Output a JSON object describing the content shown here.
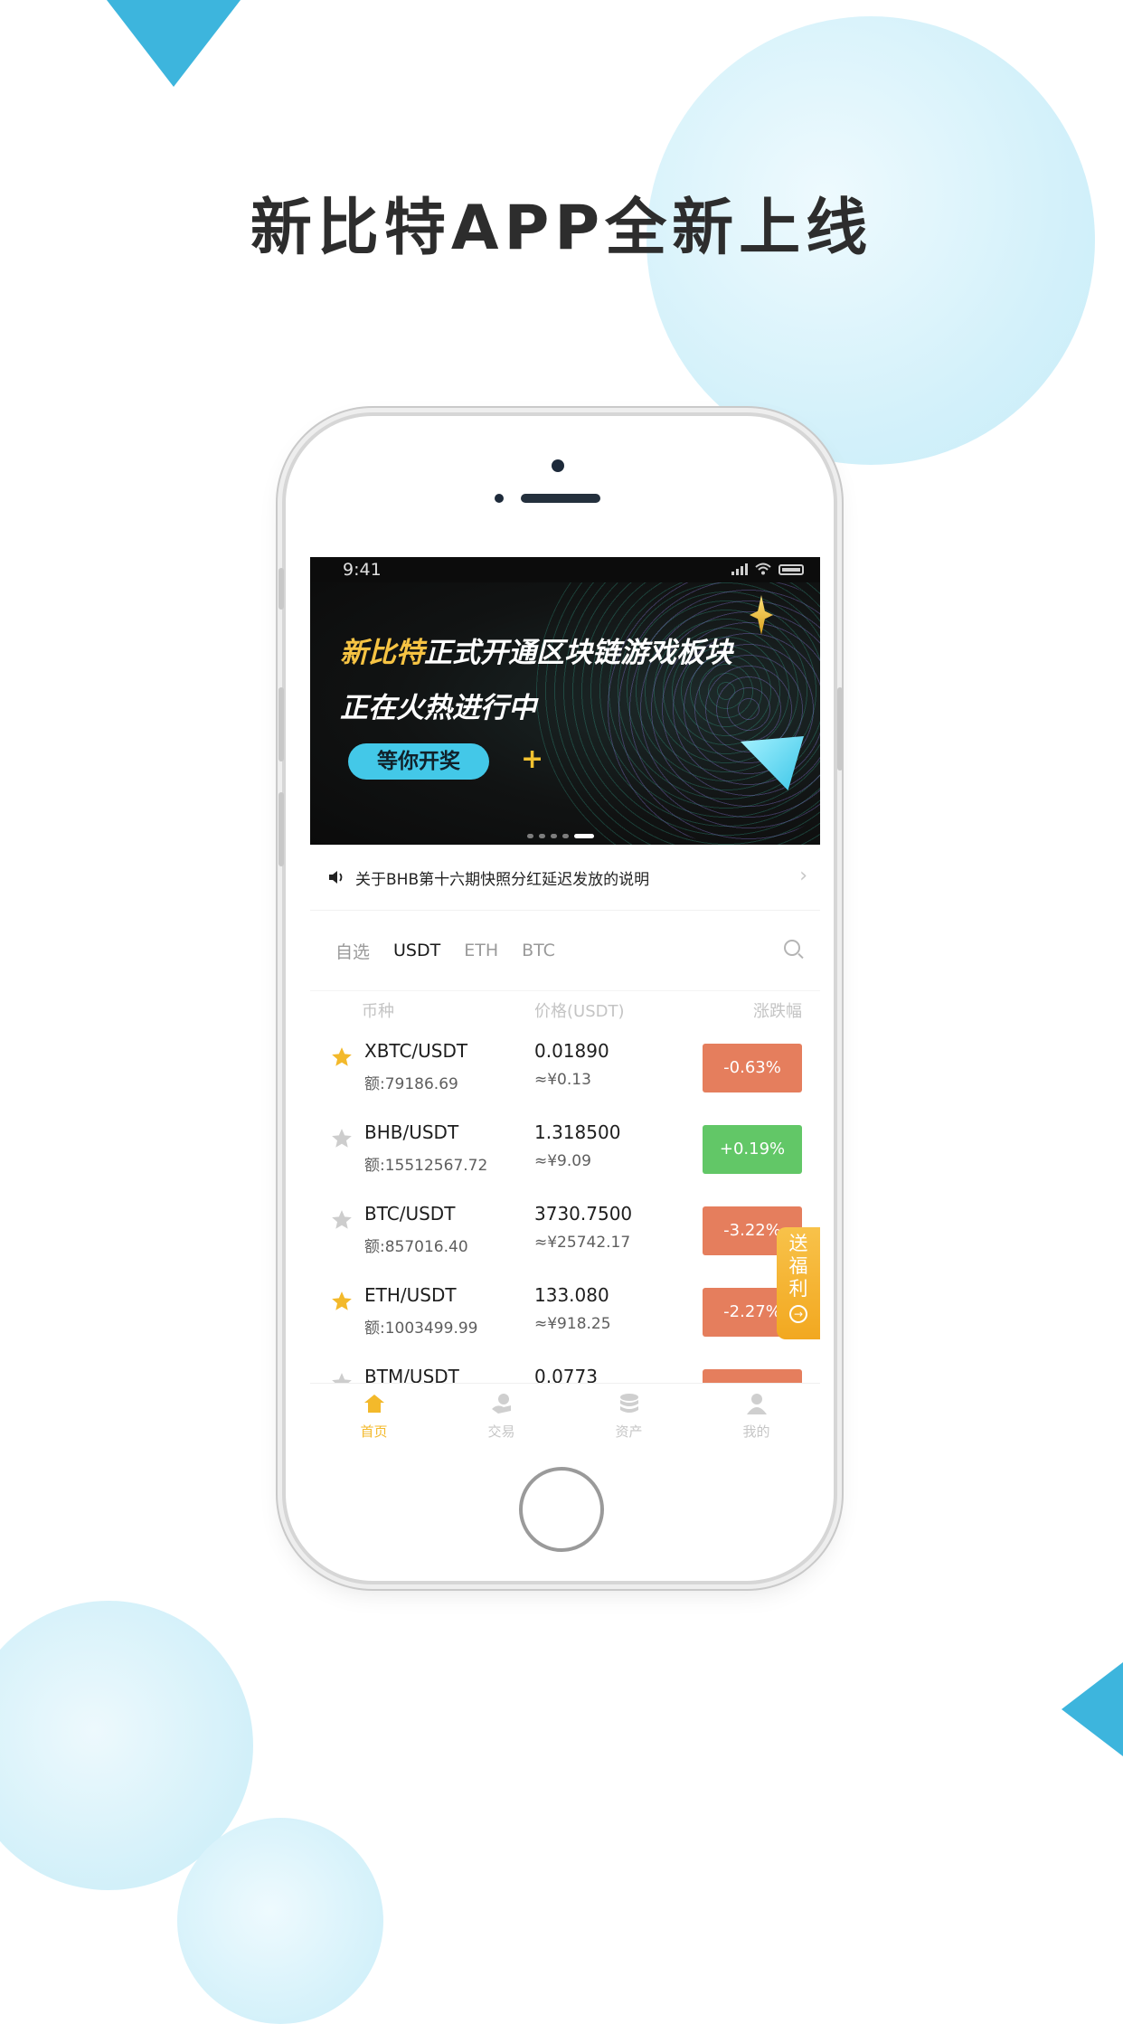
{
  "headline": "新比特APP全新上线",
  "status_bar": {
    "time": "9:41"
  },
  "banner": {
    "line1_highlight": "新比特",
    "line1_rest": "正式开通区块链游戏板块",
    "line2": "正在火热进行中",
    "cta": "等你开奖",
    "page_count": 5,
    "active_page": 5
  },
  "notice": {
    "text": "关于BHB第十六期快照分红延迟发放的说明"
  },
  "tabs": [
    {
      "label": "自选",
      "active": false
    },
    {
      "label": "USDT",
      "active": true
    },
    {
      "label": "ETH",
      "active": false
    },
    {
      "label": "BTC",
      "active": false
    }
  ],
  "table": {
    "headers": {
      "coin": "币种",
      "price": "价格(USDT)",
      "change": "涨跌幅"
    },
    "rows": [
      {
        "pair": "XBTC/USDT",
        "volume": "额:79186.69",
        "price": "0.01890",
        "cny": "≈¥0.13",
        "change": "-0.63%",
        "direction": "down",
        "starred": true
      },
      {
        "pair": "BHB/USDT",
        "volume": "额:15512567.72",
        "price": "1.318500",
        "cny": "≈¥9.09",
        "change": "+0.19%",
        "direction": "up",
        "starred": false
      },
      {
        "pair": "BTC/USDT",
        "volume": "额:857016.40",
        "price": "3730.7500",
        "cny": "≈¥25742.17",
        "change": "-3.22%",
        "direction": "down",
        "starred": false
      },
      {
        "pair": "ETH/USDT",
        "volume": "额:1003499.99",
        "price": "133.080",
        "cny": "≈¥918.25",
        "change": "-2.27%",
        "direction": "down",
        "starred": true
      },
      {
        "pair": "BTM/USDT",
        "volume": "",
        "price": "0.0773",
        "cny": "",
        "change": "",
        "direction": "down",
        "starred": false
      }
    ]
  },
  "promo": {
    "chars": [
      "送",
      "福",
      "利"
    ],
    "icon": "arrow-right-circle-icon"
  },
  "tabbar": [
    {
      "label": "首页",
      "icon": "home-icon",
      "active": true
    },
    {
      "label": "交易",
      "icon": "trade-icon",
      "active": false
    },
    {
      "label": "资产",
      "icon": "assets-icon",
      "active": false
    },
    {
      "label": "我的",
      "icon": "user-icon",
      "active": false
    }
  ],
  "colors": {
    "accent_blue": "#3db5dd",
    "down_red": "#e57e5d",
    "up_green": "#62c767",
    "active_gold": "#f3b92b",
    "star_gold": "#f3b92b",
    "star_grey": "#cdcdcd"
  }
}
